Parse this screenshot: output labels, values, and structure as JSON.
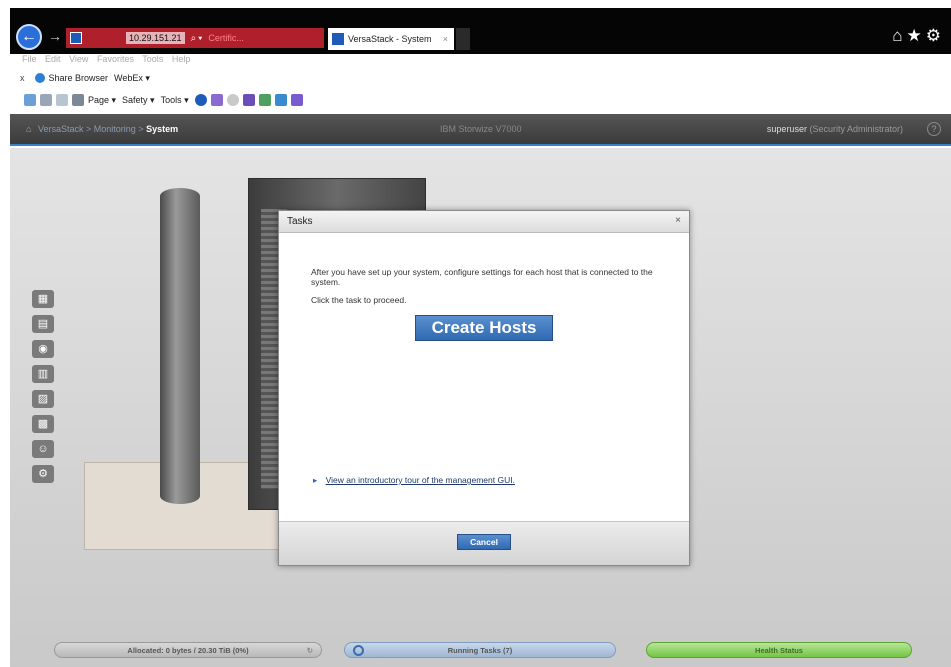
{
  "browser": {
    "address_text": "10.29.151.21",
    "cert_text": "Certific...",
    "tab_title": "VersaStack - System",
    "tab_close": "×",
    "chrome_icons": "⌂★⚙"
  },
  "menu": [
    "File",
    "Edit",
    "View",
    "Favorites",
    "Tools",
    "Help"
  ],
  "favorites": {
    "close": "x",
    "items": [
      "Share Browser",
      "WebEx ▾"
    ]
  },
  "toolbar": {
    "items": [
      "Page ▾",
      "Safety ▾",
      "Tools ▾"
    ]
  },
  "header": {
    "breadcrumb": [
      "VersaStack",
      "Monitoring"
    ],
    "breadcrumb_current": "System",
    "product": "IBM Storwize V7000",
    "user": "superuser",
    "role": "(Security Administrator)",
    "help": "?"
  },
  "dialog": {
    "title": "Tasks",
    "close": "×",
    "text": "After you have set up your system, configure settings for each host that is connected to the system.",
    "instruction": "Click the task to proceed.",
    "create_button": "Create Hosts",
    "tour_link": "View an introductory tour of the management GUI.",
    "cancel_button": "Cancel"
  },
  "status": {
    "allocated": "Allocated: 0 bytes / 20.30 TiB (0%)",
    "running_tasks": "Running Tasks (7)",
    "health": "Health Status"
  },
  "colors": {
    "accent": "#2f6ab2",
    "header": "#3b3b3b",
    "health": "#74c545"
  }
}
